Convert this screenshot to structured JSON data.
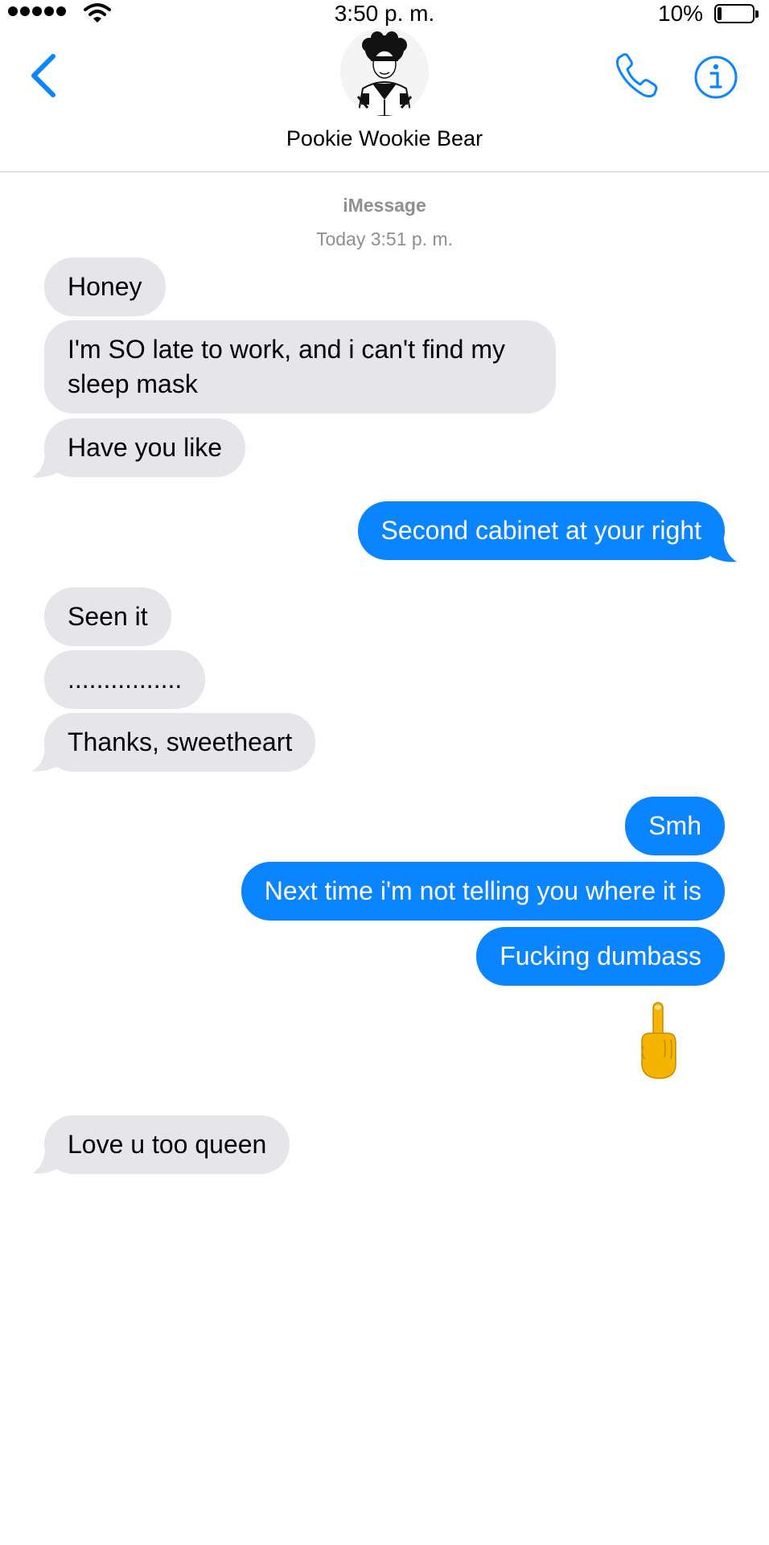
{
  "status_bar": {
    "time": "3:50 p. m.",
    "battery_percent": "10%",
    "battery_level": 0.1,
    "signal_bars": 5,
    "icons": [
      "signal-dots-icon",
      "wifi-icon",
      "battery-icon"
    ]
  },
  "header": {
    "contact_name": "Pookie Wookie Bear",
    "icons": [
      "back-chevron-icon",
      "phone-icon",
      "info-icon"
    ],
    "accent_color": "#0a84ff"
  },
  "thread": {
    "service": "iMessage",
    "timestamp": "Today 3:51 p. m."
  },
  "messages": [
    {
      "direction": "incoming",
      "text": "Honey"
    },
    {
      "direction": "incoming",
      "text": "I'm SO late to work, and i can't find my sleep mask"
    },
    {
      "direction": "incoming",
      "text": "Have you like"
    },
    {
      "direction": "outgoing",
      "text": "Second cabinet at your right"
    },
    {
      "direction": "incoming",
      "text": "Seen it"
    },
    {
      "direction": "incoming",
      "text": "................"
    },
    {
      "direction": "incoming",
      "text": "Thanks, sweetheart"
    },
    {
      "direction": "outgoing",
      "text": "Smh"
    },
    {
      "direction": "outgoing",
      "text": "Next time i'm not telling you where it is"
    },
    {
      "direction": "outgoing",
      "text": "Fucking dumbass"
    },
    {
      "direction": "outgoing",
      "emoji": "middle-finger-emoji"
    },
    {
      "direction": "incoming",
      "text": "Love u too queen"
    }
  ],
  "colors": {
    "incoming_bubble": "#e5e5ea",
    "outgoing_bubble": "#0a84ff",
    "meta_text": "#8e8e93"
  }
}
